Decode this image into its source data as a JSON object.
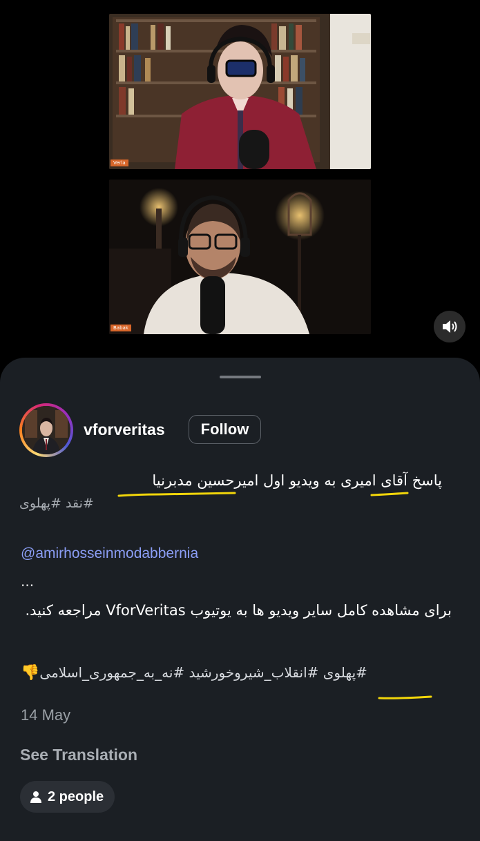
{
  "video": {
    "top_tag": "Verla",
    "bottom_tag": "Babak",
    "mute_icon": "speaker-muted-icon"
  },
  "post": {
    "username": "vforveritas",
    "follow_label": "Follow",
    "caption_line1": "پاسخ آقای امیری به ویدیو اول امیرحسین مدبرنیا",
    "caption_tags1": "#نقد #پهلوی",
    "mention": "@amirhosseinmodabbernia",
    "ellipsis": "...",
    "body": "برای مشاهده کامل سایر ویدیو ها به یوتیوب VforVeritas مراجعه کنید.",
    "hashtags": "#پهلوی #انقلاب_شیروخورشید #نه_به_جمهوری_اسلامی",
    "hashtags_emoji": "👎",
    "date": "14 May",
    "see_translation": "See Translation",
    "people_label": "2 people"
  },
  "colors": {
    "sheet_bg": "#1b1f24",
    "mention": "#8b9ef5",
    "highlight_underline": "#f2d60a",
    "name_tag": "#d8662a"
  }
}
